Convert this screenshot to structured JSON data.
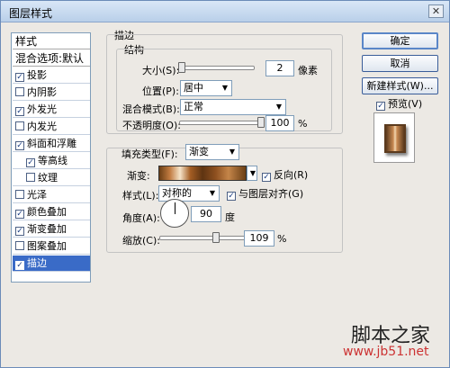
{
  "window": {
    "title": "图层样式",
    "close_label": "✕"
  },
  "style_list": {
    "header": "样式",
    "blend_default": "混合选项:默认",
    "items": [
      {
        "label": "投影",
        "checked": true
      },
      {
        "label": "内阴影",
        "checked": false
      },
      {
        "label": "外发光",
        "checked": true
      },
      {
        "label": "内发光",
        "checked": false
      },
      {
        "label": "斜面和浮雕",
        "checked": true
      },
      {
        "label": "等高线",
        "checked": true
      },
      {
        "label": "纹理",
        "checked": false
      },
      {
        "label": "光泽",
        "checked": false
      },
      {
        "label": "颜色叠加",
        "checked": true
      },
      {
        "label": "渐变叠加",
        "checked": true
      },
      {
        "label": "图案叠加",
        "checked": false
      },
      {
        "label": "描边",
        "checked": true,
        "selected": true
      }
    ]
  },
  "buttons": {
    "ok": "确定",
    "cancel": "取消",
    "new_style": "新建样式(W)...",
    "preview_label": "预览(V)",
    "preview_checked": true
  },
  "stroke": {
    "section_title": "描边",
    "structure_title": "结构",
    "size_label": "大小(S):",
    "size_value": "2",
    "size_unit": "像素",
    "size_level": 0.02,
    "position_label": "位置(P):",
    "position_value": "居中",
    "blend_label": "混合模式(B):",
    "blend_value": "正常",
    "opacity_label": "不透明度(O):",
    "opacity_value": "100",
    "opacity_unit": "%",
    "opacity_level": 1.0
  },
  "fill": {
    "fill_type_label": "填充类型(F):",
    "fill_type_value": "渐变",
    "gradient_label": "渐变:",
    "reverse_label": "反向(R)",
    "reverse_checked": true,
    "style_label": "样式(L):",
    "style_value": "对称的",
    "align_label": "与图层对齐(G)",
    "align_checked": true,
    "angle_label": "角度(A):",
    "angle_value": "90",
    "angle_unit": "度",
    "scale_label": "缩放(C):",
    "scale_value": "109",
    "scale_unit": "%",
    "scale_level": 0.55
  },
  "watermark": {
    "site_name": "脚本之家",
    "url": "www.jb51.net"
  },
  "colors": {
    "selection": "#3a6bc7",
    "titlebar": "#c8dbf0",
    "panel": "#ece9e4",
    "watermark_url": "#cc3333"
  }
}
